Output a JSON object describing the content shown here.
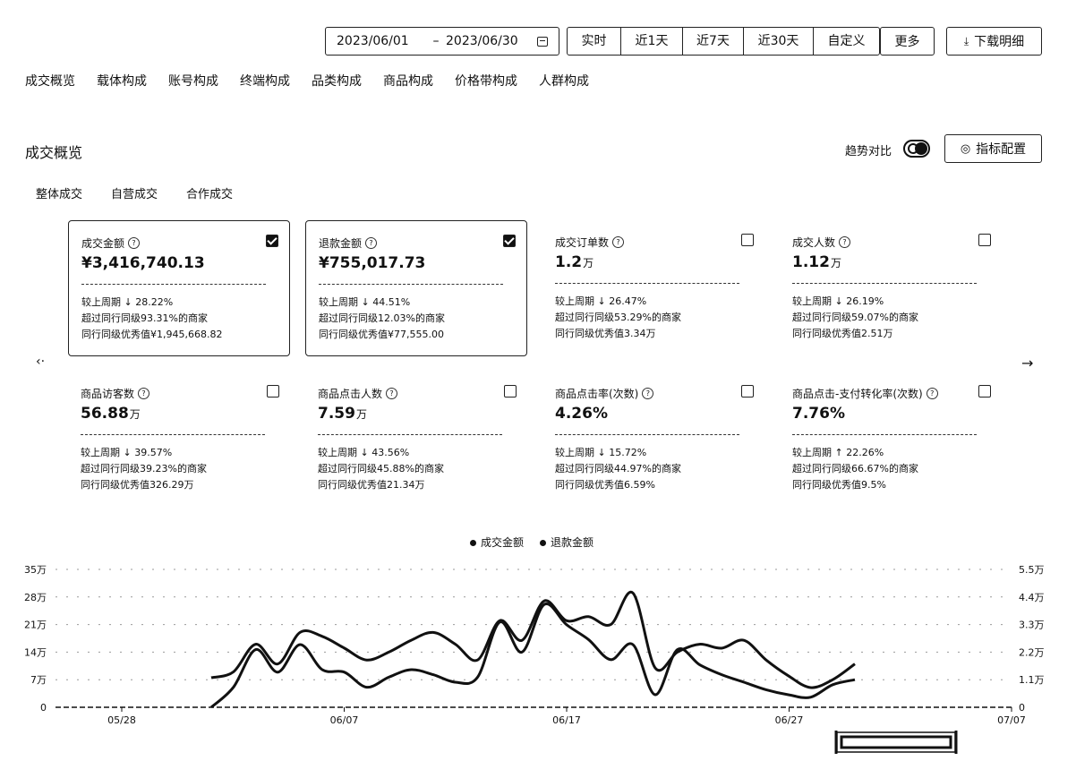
{
  "toolbar": {
    "date_start": "2023/06/01",
    "date_sep": "–",
    "date_end": "2023/06/30",
    "ranges": [
      "实时",
      "近1天",
      "近7天",
      "近30天",
      "自定义"
    ],
    "more": "更多",
    "download": "下载明细"
  },
  "nav_tabs": [
    "成交概览",
    "载体构成",
    "账号构成",
    "终端构成",
    "品类构成",
    "商品构成",
    "价格带构成",
    "人群构成"
  ],
  "section": {
    "title": "成交概览",
    "trend_label": "趋势对比",
    "config": "指标配置",
    "sub_tabs": [
      "整体成交",
      "自营成交",
      "合作成交"
    ]
  },
  "cards": [
    {
      "label": "成交金额",
      "value": "¥3,416,740.13",
      "unit": "",
      "checked": true,
      "l1": "较上周期 ↓ 28.22%",
      "l2": "超过同行同级93.31%的商家",
      "l3": "同行同级优秀值¥1,945,668.82"
    },
    {
      "label": "退款金额",
      "value": "¥755,017.73",
      "unit": "",
      "checked": true,
      "l1": "较上周期 ↓ 44.51%",
      "l2": "超过同行同级12.03%的商家",
      "l3": "同行同级优秀值¥77,555.00"
    },
    {
      "label": "成交订单数",
      "value": "1.2",
      "unit": "万",
      "checked": false,
      "l1": "较上周期 ↓ 26.47%",
      "l2": "超过同行同级53.29%的商家",
      "l3": "同行同级优秀值3.34万"
    },
    {
      "label": "成交人数",
      "value": "1.12",
      "unit": "万",
      "checked": false,
      "l1": "较上周期 ↓ 26.19%",
      "l2": "超过同行同级59.07%的商家",
      "l3": "同行同级优秀值2.51万"
    },
    {
      "label": "商品访客数",
      "value": "56.88",
      "unit": "万",
      "checked": false,
      "l1": "较上周期 ↓ 39.57%",
      "l2": "超过同行同级39.23%的商家",
      "l3": "同行同级优秀值326.29万"
    },
    {
      "label": "商品点击人数",
      "value": "7.59",
      "unit": "万",
      "checked": false,
      "l1": "较上周期 ↓ 43.56%",
      "l2": "超过同行同级45.88%的商家",
      "l3": "同行同级优秀值21.34万"
    },
    {
      "label": "商品点击率(次数)",
      "value": "4.26%",
      "unit": "",
      "checked": false,
      "l1": "较上周期 ↓ 15.72%",
      "l2": "超过同行同级44.97%的商家",
      "l3": "同行同级优秀值6.59%"
    },
    {
      "label": "商品点击-支付转化率(次数)",
      "value": "7.76%",
      "unit": "",
      "checked": false,
      "l1": "较上周期 ↑ 22.26%",
      "l2": "超过同行同级66.67%的商家",
      "l3": "同行同级优秀值9.5%"
    }
  ],
  "chart_data": {
    "type": "line",
    "legend": [
      "成交金额",
      "退款金额"
    ],
    "y_left_ticks": [
      "0",
      "7万",
      "14万",
      "21万",
      "28万",
      "35万"
    ],
    "y_right_ticks": [
      "0",
      "1.1万",
      "2.2万",
      "3.3万",
      "4.4万",
      "5.5万"
    ],
    "ylim_left": [
      0,
      35
    ],
    "ylim_right": [
      0,
      5.5
    ],
    "x_ticks": [
      "05/28",
      "06/07",
      "06/17",
      "06/27",
      "07/07"
    ],
    "x": [
      "06/01",
      "06/02",
      "06/03",
      "06/04",
      "06/05",
      "06/06",
      "06/07",
      "06/08",
      "06/09",
      "06/10",
      "06/11",
      "06/12",
      "06/13",
      "06/14",
      "06/15",
      "06/16",
      "06/17",
      "06/18",
      "06/19",
      "06/20",
      "06/21",
      "06/22",
      "06/23",
      "06/24",
      "06/25",
      "06/26",
      "06/27",
      "06/28",
      "06/29",
      "06/30"
    ],
    "series": [
      {
        "name": "成交金额",
        "axis": "left",
        "values": [
          7.5,
          9,
          16,
          11,
          19,
          18,
          15,
          12,
          14,
          17,
          19,
          16,
          12,
          22,
          17,
          27,
          22,
          23,
          21,
          29,
          10,
          14,
          16,
          15,
          17,
          12,
          8,
          5,
          7,
          11
        ]
      },
      {
        "name": "退款金额",
        "axis": "right",
        "values": [
          0,
          0.8,
          2.3,
          1.4,
          2.5,
          1.5,
          1.4,
          0.8,
          1.2,
          1.5,
          1.3,
          1.0,
          1.2,
          3.4,
          2.2,
          4.1,
          3.3,
          2.7,
          1.9,
          2.5,
          0.5,
          2.3,
          1.7,
          1.3,
          1.0,
          0.7,
          0.5,
          0.4,
          0.9,
          1.1
        ]
      }
    ]
  }
}
